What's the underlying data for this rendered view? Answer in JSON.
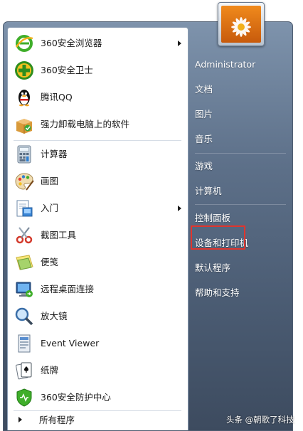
{
  "programs": [
    {
      "label": "360安全浏览器",
      "icon": "ie-360-browser-icon",
      "has_submenu": true
    },
    {
      "label": "360安全卫士",
      "icon": "360-safeguard-icon",
      "has_submenu": false
    },
    {
      "label": "腾讯QQ",
      "icon": "qq-penguin-icon",
      "has_submenu": false
    },
    {
      "label": "强力卸载电脑上的软件",
      "icon": "uninstall-box-icon",
      "has_submenu": false
    },
    {
      "label": "计算器",
      "icon": "calculator-icon",
      "has_submenu": false
    },
    {
      "label": "画图",
      "icon": "paint-palette-icon",
      "has_submenu": false
    },
    {
      "label": "入门",
      "icon": "getting-started-icon",
      "has_submenu": true
    },
    {
      "label": "截图工具",
      "icon": "snipping-tool-icon",
      "has_submenu": false
    },
    {
      "label": "便笺",
      "icon": "sticky-notes-icon",
      "has_submenu": false
    },
    {
      "label": "远程桌面连接",
      "icon": "remote-desktop-icon",
      "has_submenu": false
    },
    {
      "label": "放大镜",
      "icon": "magnifier-icon",
      "has_submenu": false
    },
    {
      "label": "Event Viewer",
      "icon": "event-viewer-icon",
      "has_submenu": false
    },
    {
      "label": "纸牌",
      "icon": "solitaire-icon",
      "has_submenu": false
    },
    {
      "label": "360安全防护中心",
      "icon": "360-shield-icon",
      "has_submenu": false
    }
  ],
  "all_programs_label": "所有程序",
  "right_links": [
    {
      "label": "Administrator"
    },
    {
      "label": "文档"
    },
    {
      "label": "图片"
    },
    {
      "label": "音乐"
    },
    {
      "label": "游戏"
    },
    {
      "label": "计算机"
    },
    {
      "label": "控制面板",
      "highlighted": true
    },
    {
      "label": "设备和打印机"
    },
    {
      "label": "默认程序"
    },
    {
      "label": "帮助和支持"
    }
  ],
  "user_picture_icon": "flower-user-picture-icon",
  "watermark": "头条 @朝歌了科技",
  "colors": {
    "menu_bg": "#5d7089",
    "left_pane_bg": "#ffffff",
    "highlight_box": "#e0352d",
    "right_link_text": "#ffffff"
  }
}
